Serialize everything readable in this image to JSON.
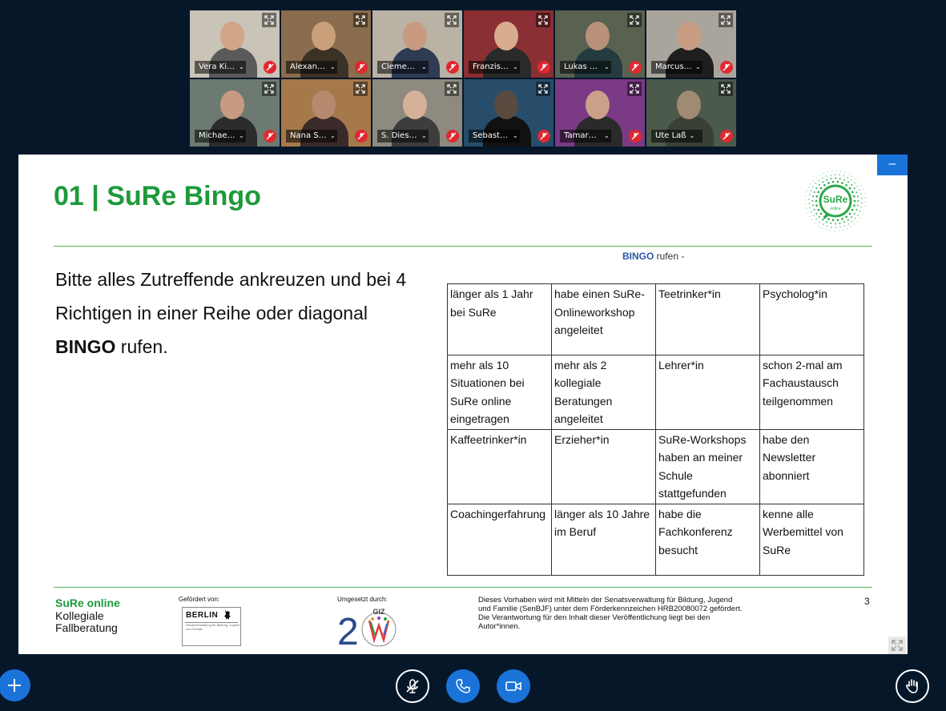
{
  "participants": [
    {
      "name": "Vera Kia…",
      "bg": "#c9c3b8",
      "skin": "#d2a488",
      "shirt": "#5a5a5a"
    },
    {
      "name": "Alexand…",
      "bg": "#8a6d4e",
      "skin": "#caa07a",
      "shirt": "#3b3226"
    },
    {
      "name": "Clemen…",
      "bg": "#b9b2a5",
      "skin": "#c89a80",
      "shirt": "#2e3b52"
    },
    {
      "name": "Franzisk…",
      "bg": "#8a2f33",
      "skin": "#d9ac8f",
      "shirt": "#2a2a2a"
    },
    {
      "name": "Lukas H…",
      "bg": "#596150",
      "skin": "#b89178",
      "shirt": "#243c3f"
    },
    {
      "name": "Marcus …",
      "bg": "#a9a49c",
      "skin": "#c99c84",
      "shirt": "#1f1f1f"
    },
    {
      "name": "Michael …",
      "bg": "#6d7a71",
      "skin": "#c79b80",
      "shirt": "#2c2c2c"
    },
    {
      "name": "Nana Sh…",
      "bg": "#a6794b",
      "skin": "#b58a6e",
      "shirt": "#3a2a2a"
    },
    {
      "name": "S. Diesb…",
      "bg": "#8e8a80",
      "skin": "#d5b19a",
      "shirt": "#3d3d3d"
    },
    {
      "name": "Sebasti…",
      "bg": "#274d6a",
      "skin": "#5a4a3f",
      "shirt": "#111111"
    },
    {
      "name": "Tamara …",
      "bg": "#7a3a85",
      "skin": "#caa088",
      "shirt": "#2a2a2a"
    },
    {
      "name": "Ute Laß",
      "bg": "#4c5a4c",
      "skin": "#a08a74",
      "shirt": "#3a4036"
    }
  ],
  "slide": {
    "title": "01 | SuRe Bingo",
    "logo_main": "SuRe",
    "logo_sub": "online",
    "fragment_bold": "BINGO",
    "fragment_rest": " rufen -",
    "instruction_pre": "Bitte alles Zutreffende ankreuzen und bei 4 Richtigen in einer Reihe oder diagonal ",
    "instruction_bold": "BINGO",
    "instruction_post": " rufen.",
    "grid": [
      [
        "länger als 1 Jahr bei SuRe",
        "habe einen SuRe-Onlineworkshop angeleitet",
        "Teetrinker*in",
        "Psycholog*in"
      ],
      [
        "mehr als 10 Situationen bei SuRe online eingetragen",
        "mehr als 2 kollegiale Beratungen angeleitet",
        "Lehrer*in",
        "schon 2-mal am Fachaustausch teilgenommen"
      ],
      [
        "Kaffeetrinker*in",
        "Erzieher*in",
        "SuRe-Workshops haben an meiner Schule stattgefunden",
        "habe den Newsletter abonniert"
      ],
      [
        "Coachingerfahrung",
        "länger als 10 Jahre im Beruf",
        "habe die Fachkonferenz besucht",
        "kenne alle Werbemittel von SuRe"
      ]
    ],
    "footer": {
      "brand": "SuRe online",
      "line2": "Kollegiale",
      "line3": "Fallberatung",
      "funded_label": "Gefördert von:",
      "berlin": "BERLIN",
      "berlin_sub": "Senatsverwaltung für Bildung, Jugend und Familie",
      "implemented_label": "Umgesetzt durch:",
      "giz": "GIZ",
      "logo_number": "2",
      "text": "Dieses Vorhaben wird mit Mitteln der Senatsverwaltung für Bildung, Jugend und Familie (SenBJF) unter dem Förderkennzeichen HRB20080072 gefördert. Die Verantwortung für den Inhalt dieser Veröffentlichung liegt bei den Autor*innen.",
      "page": "3"
    },
    "minimize_label": "–"
  },
  "controls": {
    "accent": "#1a73d9",
    "icons": [
      "plus-icon",
      "mic-off-icon",
      "phone-icon",
      "camera-icon",
      "raise-hand-icon"
    ]
  }
}
